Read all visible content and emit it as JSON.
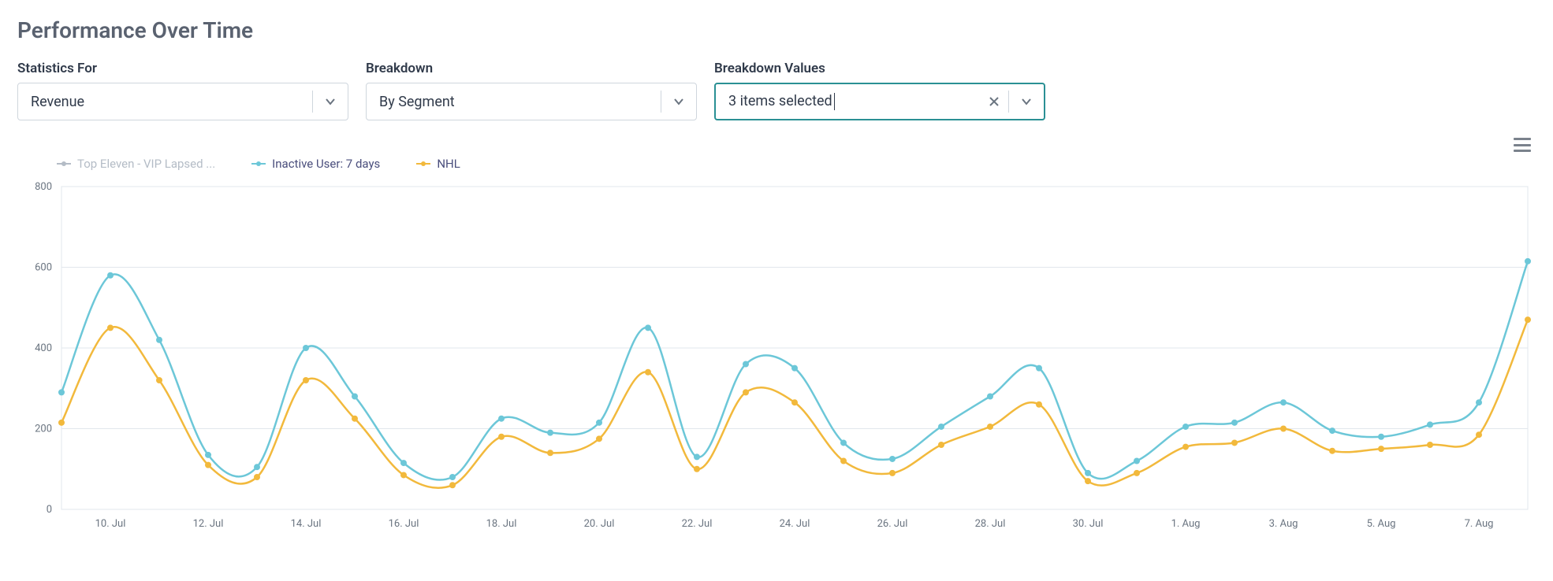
{
  "title": "Performance Over Time",
  "controls": {
    "statisticsFor": {
      "label": "Statistics For",
      "value": "Revenue"
    },
    "breakdown": {
      "label": "Breakdown",
      "value": "By Segment"
    },
    "breakdownValues": {
      "label": "Breakdown Values",
      "value": "3 items selected"
    }
  },
  "legend": {
    "topEleven": "Top Eleven - VIP Lapsed ...",
    "inactive": "Inactive User: 7 days",
    "nhl": "NHL"
  },
  "colors": {
    "grey": "#b4bcc6",
    "blue": "#6cc7d8",
    "yellow": "#f2b93c"
  },
  "chart_data": {
    "type": "line",
    "title": "Performance Over Time",
    "xlabel": "",
    "ylabel": "",
    "ylim": [
      0,
      800
    ],
    "yticks": [
      0,
      200,
      400,
      600,
      800
    ],
    "grid": true,
    "legend_position": "top-left",
    "categories": [
      "9. Jul",
      "10. Jul",
      "11. Jul",
      "12. Jul",
      "13. Jul",
      "14. Jul",
      "15. Jul",
      "16. Jul",
      "17. Jul",
      "18. Jul",
      "19. Jul",
      "20. Jul",
      "21. Jul",
      "22. Jul",
      "23. Jul",
      "24. Jul",
      "25. Jul",
      "26. Jul",
      "27. Jul",
      "28. Jul",
      "29. Jul",
      "30. Jul",
      "31. Jul",
      "1. Aug",
      "2. Aug",
      "3. Aug",
      "4. Aug",
      "5. Aug",
      "6. Aug",
      "7. Aug",
      "8. Aug"
    ],
    "xtick_labels": [
      "10. Jul",
      "12. Jul",
      "14. Jul",
      "16. Jul",
      "18. Jul",
      "20. Jul",
      "22. Jul",
      "24. Jul",
      "26. Jul",
      "28. Jul",
      "30. Jul",
      "1. Aug",
      "3. Aug",
      "5. Aug",
      "7. Aug"
    ],
    "xtick_indices": [
      1,
      3,
      5,
      7,
      9,
      11,
      13,
      15,
      17,
      19,
      21,
      23,
      25,
      27,
      29
    ],
    "series": [
      {
        "name": "Top Eleven - VIP Lapsed ...",
        "color": "#b4bcc6",
        "visible": false,
        "values": [
          null,
          null,
          null,
          null,
          null,
          null,
          null,
          null,
          null,
          null,
          null,
          null,
          null,
          null,
          null,
          null,
          null,
          null,
          null,
          null,
          null,
          null,
          null,
          null,
          null,
          null,
          null,
          null,
          null,
          null,
          null
        ]
      },
      {
        "name": "Inactive User: 7 days",
        "color": "#6cc7d8",
        "visible": true,
        "values": [
          290,
          580,
          420,
          135,
          105,
          400,
          280,
          115,
          80,
          225,
          190,
          215,
          450,
          130,
          360,
          350,
          165,
          125,
          205,
          280,
          350,
          90,
          120,
          205,
          215,
          265,
          195,
          180,
          210,
          265,
          615
        ]
      },
      {
        "name": "NHL",
        "color": "#f2b93c",
        "visible": true,
        "values": [
          215,
          450,
          320,
          110,
          80,
          320,
          225,
          85,
          60,
          180,
          140,
          175,
          340,
          100,
          290,
          265,
          120,
          90,
          160,
          205,
          260,
          70,
          90,
          155,
          165,
          200,
          145,
          150,
          160,
          185,
          470
        ]
      }
    ]
  }
}
